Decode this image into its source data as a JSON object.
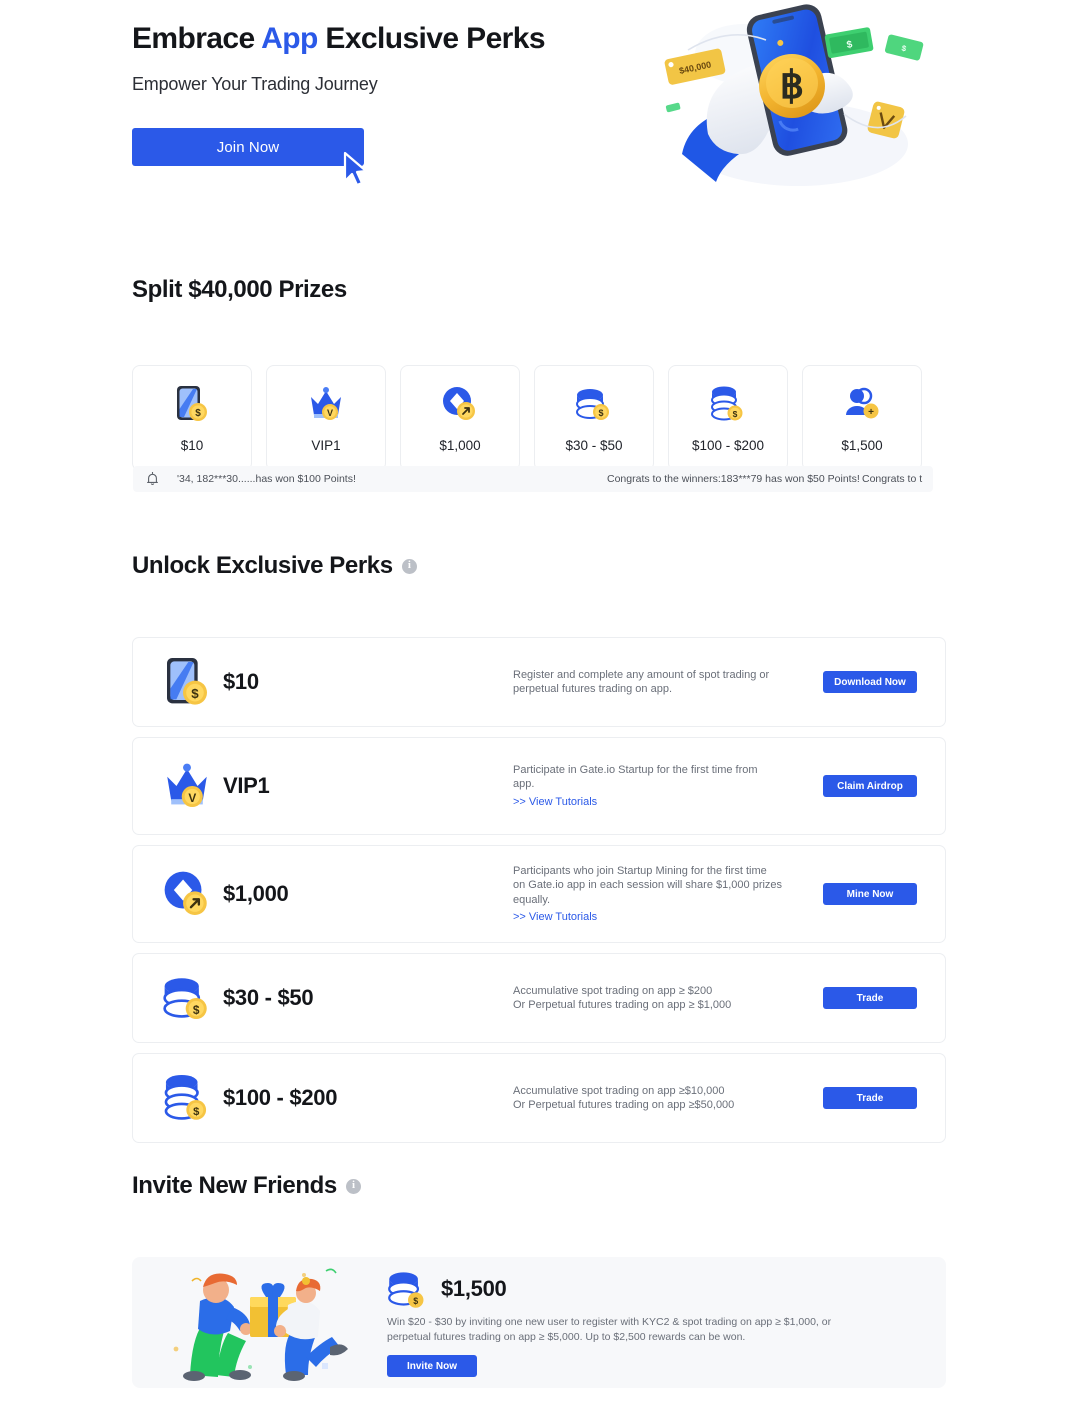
{
  "hero": {
    "title_part1": "Embrace ",
    "title_accent": "App",
    "title_part2": " Exclusive Perks",
    "subtitle": "Empower Your Trading Journey",
    "join_label": "Join Now",
    "art_name": "hand-holding-phone-bitcoin-illustration",
    "art_price_tag": "$40,000",
    "cursor_name": "mouse-cursor-pointer"
  },
  "prizes": {
    "title": "Split $40,000 Prizes",
    "cards": [
      {
        "label": "$10",
        "icon": "phone-coin-icon"
      },
      {
        "label": "VIP1",
        "icon": "crown-vip-icon"
      },
      {
        "label": "$1,000",
        "icon": "mining-coin-icon"
      },
      {
        "label": "$30 - $50",
        "icon": "coin-stack-icon"
      },
      {
        "label": "$100 - $200",
        "icon": "coin-stack-tall-icon"
      },
      {
        "label": "$1,500",
        "icon": "invite-friends-icon"
      }
    ]
  },
  "ticker": {
    "icon": "bell-icon",
    "items": [
      "'34, 182***30......has won $100 Points!",
      "Congrats to the winners:183***79 has won $50 Points!",
      "Congrats to t"
    ]
  },
  "perks": {
    "title": "Unlock Exclusive Perks",
    "info_glyph": "i",
    "rows": [
      {
        "amount": "$10",
        "icon": "phone-coin-icon",
        "desc_lines": [
          "Register and complete any amount of spot trading or",
          "perpetual futures trading on app."
        ],
        "tutorial": null,
        "button": "Download Now"
      },
      {
        "amount": "VIP1",
        "icon": "crown-vip-icon",
        "desc_lines": [
          "Participate in Gate.io Startup for the first time from",
          "app."
        ],
        "tutorial": ">> View Tutorials",
        "button": "Claim Airdrop"
      },
      {
        "amount": "$1,000",
        "icon": "mining-coin-icon",
        "desc_lines": [
          "Participants who join Startup Mining for the first time",
          "on Gate.io app in each session will share $1,000 prizes",
          "equally."
        ],
        "tutorial": ">> View Tutorials",
        "button": "Mine Now"
      },
      {
        "amount": "$30 - $50",
        "icon": "coin-stack-icon",
        "desc_lines": [
          "Accumulative spot trading on app ≥ $200",
          "Or Perpetual futures trading on app ≥ $1,000"
        ],
        "tutorial": null,
        "button": "Trade"
      },
      {
        "amount": "$100 - $200",
        "icon": "coin-stack-tall-icon",
        "desc_lines": [
          "Accumulative spot trading on app ≥$10,000",
          "Or Perpetual futures trading on app ≥$50,000"
        ],
        "tutorial": null,
        "button": "Trade"
      }
    ]
  },
  "invite": {
    "title": "Invite New Friends",
    "info_glyph": "i",
    "art_name": "two-people-exchanging-gift-illustration",
    "amount": "$1,500",
    "icon": "coin-stack-icon",
    "desc": "Win $20 - $30 by inviting one new user to register with KYC2 & spot trading on app ≥ $1,000, or perpetual futures trading on app ≥ $5,000. Up to $2,500 rewards can be won.",
    "button": "Invite Now"
  },
  "colors": {
    "brand_blue": "#2b59e8",
    "coin_yellow": "#f6c544",
    "text_dark": "#14161a",
    "text_muted": "#6a6f79",
    "panel_bg": "#f7f8fa",
    "border": "#eceef1"
  }
}
